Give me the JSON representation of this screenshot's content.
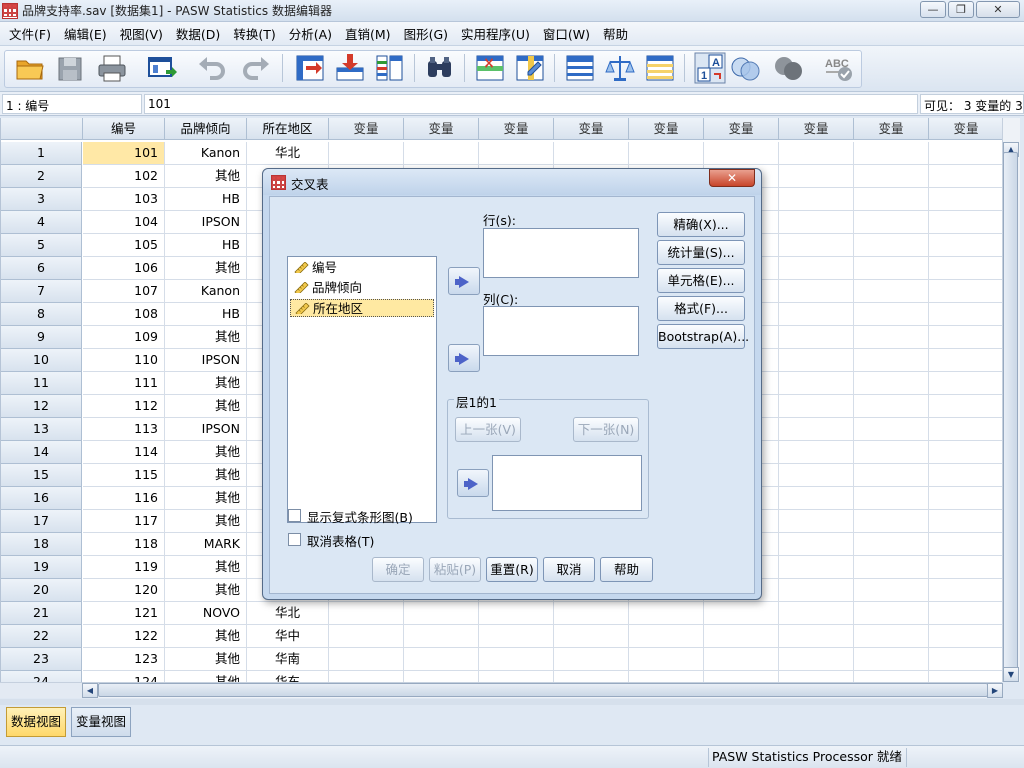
{
  "window": {
    "title": "品牌支持率.sav [数据集1] - PASW Statistics 数据编辑器"
  },
  "menu": [
    "文件(F)",
    "编辑(E)",
    "视图(V)",
    "数据(D)",
    "转换(T)",
    "分析(A)",
    "直销(M)",
    "图形(G)",
    "实用程序(U)",
    "窗口(W)",
    "帮助"
  ],
  "toolbar_icons": [
    "open-folder-icon",
    "save-icon",
    "print-icon",
    "dialog-recall-icon",
    "undo-icon",
    "redo-icon",
    "goto-case-icon",
    "goto-variable-icon",
    "variables-icon",
    "find-icon",
    "insert-case-icon",
    "insert-variable-icon",
    "split-file-icon",
    "weight-cases-icon",
    "select-cases-icon",
    "value-labels-icon",
    "use-sets-icon",
    "show-all-variables-icon",
    "spell-check-icon"
  ],
  "cell_locator": {
    "ref": "1 : 编号",
    "value": "101",
    "visible": "可见： 3 变量的 3"
  },
  "grid": {
    "columns": [
      "编号",
      "品牌倾向",
      "所在地区",
      "变量",
      "变量",
      "变量",
      "变量",
      "变量",
      "变量",
      "变量",
      "变量",
      "变量"
    ],
    "rows": [
      [
        "1",
        "101",
        "Kanon",
        "华北"
      ],
      [
        "2",
        "102",
        "其他",
        ""
      ],
      [
        "3",
        "103",
        "HB",
        ""
      ],
      [
        "4",
        "104",
        "IPSON",
        ""
      ],
      [
        "5",
        "105",
        "HB",
        ""
      ],
      [
        "6",
        "106",
        "其他",
        ""
      ],
      [
        "7",
        "107",
        "Kanon",
        ""
      ],
      [
        "8",
        "108",
        "HB",
        ""
      ],
      [
        "9",
        "109",
        "其他",
        ""
      ],
      [
        "10",
        "110",
        "IPSON",
        ""
      ],
      [
        "11",
        "111",
        "其他",
        ""
      ],
      [
        "12",
        "112",
        "其他",
        ""
      ],
      [
        "13",
        "113",
        "IPSON",
        ""
      ],
      [
        "14",
        "114",
        "其他",
        ""
      ],
      [
        "15",
        "115",
        "其他",
        ""
      ],
      [
        "16",
        "116",
        "其他",
        ""
      ],
      [
        "17",
        "117",
        "其他",
        ""
      ],
      [
        "18",
        "118",
        "MARK",
        ""
      ],
      [
        "19",
        "119",
        "其他",
        ""
      ],
      [
        "20",
        "120",
        "其他",
        ""
      ],
      [
        "21",
        "121",
        "NOVO",
        "华北"
      ],
      [
        "22",
        "122",
        "其他",
        "华中"
      ],
      [
        "23",
        "123",
        "其他",
        "华南"
      ],
      [
        "24",
        "124",
        "其他",
        "华东"
      ]
    ]
  },
  "tabs": {
    "data_view": "数据视图",
    "variable_view": "变量视图"
  },
  "status": {
    "processor": "PASW Statistics Processor 就绪"
  },
  "dialog": {
    "title": "交叉表",
    "close_label": "✕",
    "variables": [
      "编号",
      "品牌倾向",
      "所在地区"
    ],
    "rows_label": "行(s):",
    "cols_label": "列(C):",
    "layer_label": "层1的1",
    "prev_label": "上一张(V)",
    "next_label": "下一张(N)",
    "side_buttons": [
      "精确(X)...",
      "统计量(S)...",
      "单元格(E)...",
      "格式(F)...",
      "Bootstrap(A)..."
    ],
    "check_clustered": "显示复式条形图(B)",
    "check_suppress": "取消表格(T)",
    "bottom_buttons": [
      "确定",
      "粘贴(P)",
      "重置(R)",
      "取消",
      "帮助"
    ]
  }
}
